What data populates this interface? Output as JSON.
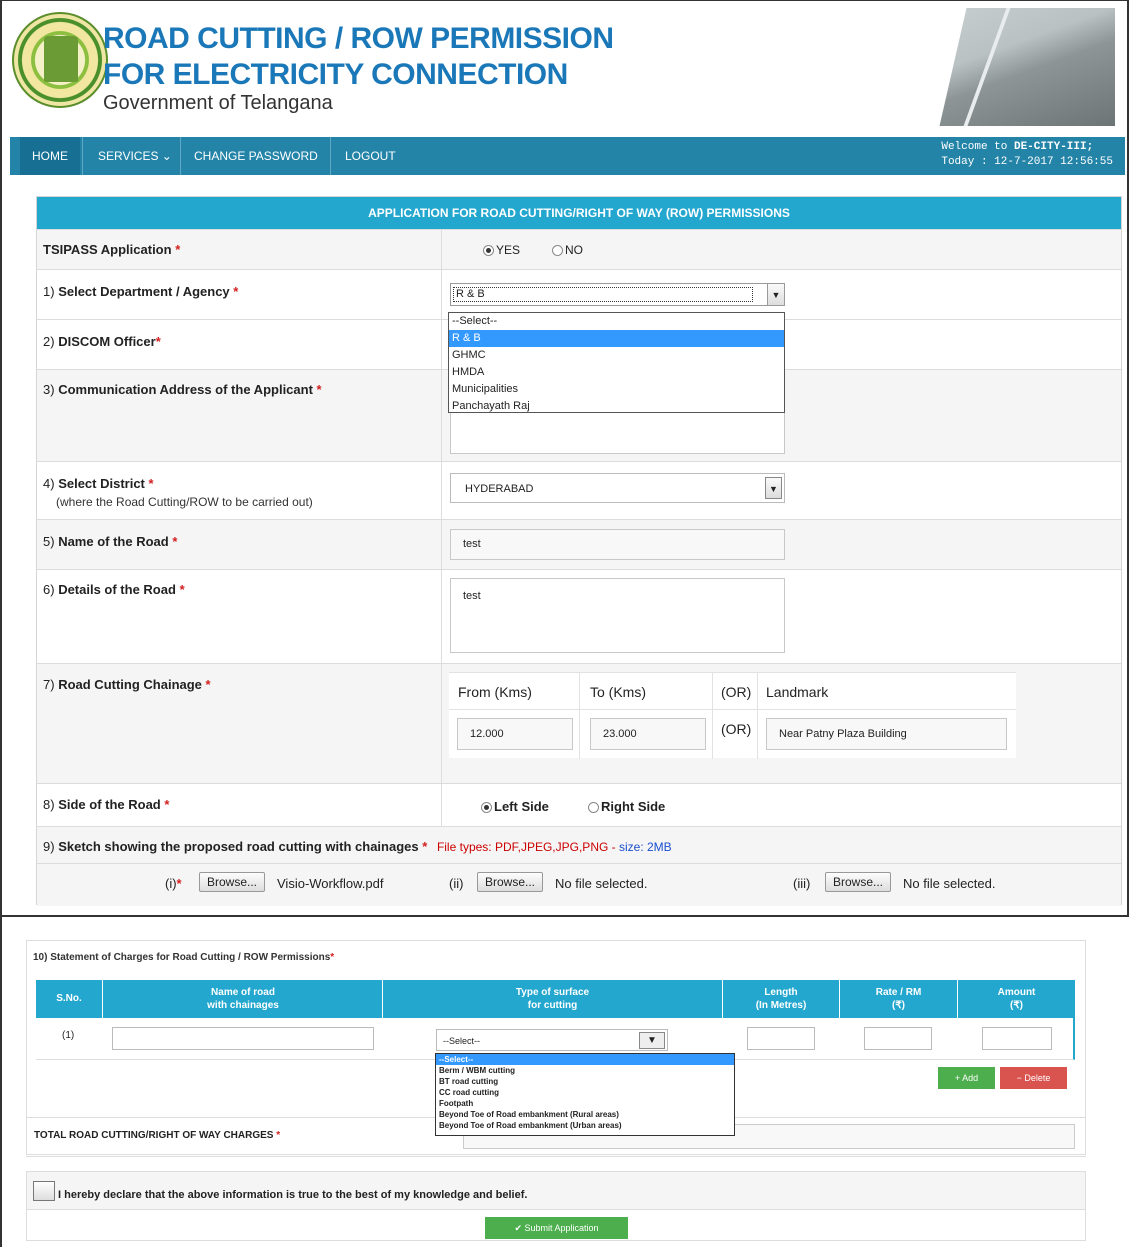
{
  "header": {
    "title_line1": "ROAD CUTTING / ROW PERMISSION",
    "title_line2": "FOR ELECTRICITY CONNECTION",
    "subtitle": "Government of Telangana",
    "emblem_text": "GOVERNMENT OF TELANGANA"
  },
  "nav": {
    "items": [
      "HOME",
      "SERVICES ⌄",
      "CHANGE PASSWORD",
      "LOGOUT"
    ],
    "welcome_prefix": "Welcome to ",
    "welcome_user": "DE-CITY-III;",
    "today": "Today : 12-7-2017 12:56:55"
  },
  "form": {
    "heading": "APPLICATION FOR ROAD CUTTING/RIGHT OF WAY (ROW) PERMISSIONS",
    "tsipass_label": "TSIPASS Application",
    "yes": "YES",
    "no": "NO",
    "dept_num": "1)",
    "dept_label": "Select Department / Agency",
    "dept_value": "R & B",
    "dept_options": [
      "--Select--",
      "R & B",
      "GHMC",
      "HMDA",
      "Municipalities",
      "Panchayath Raj"
    ],
    "discom_num": "2)",
    "discom_label": "DISCOM Officer",
    "address_num": "3)",
    "address_label": "Communication Address of the Applicant",
    "district_num": "4)",
    "district_label": "Select District",
    "district_note": "(where the Road Cutting/ROW to be carried out)",
    "district_value": "HYDERABAD",
    "road_num": "5)",
    "road_label": "Name of the Road",
    "road_value": "test",
    "details_num": "6)",
    "details_label": "Details of the Road",
    "details_value": "test",
    "chain_num": "7)",
    "chain_label": "Road Cutting Chainage",
    "from_label": "From (Kms)",
    "to_label": "To (Kms)",
    "or": "(OR)",
    "landmark_label": "Landmark",
    "from_value": "12.000",
    "to_value": "23.000",
    "landmark_value": "Near Patny Plaza Building",
    "side_num": "8)",
    "side_label": "Side of the Road",
    "left_side": "Left Side",
    "right_side": "Right Side",
    "sketch_num": "9)",
    "sketch_label": "Sketch showing the proposed road cutting with chainages",
    "file_types": "File types: PDF,JPEG,JPG,PNG",
    "size_sep": " - ",
    "size": "size: 2MB",
    "file1_idx": "(i)",
    "file2_idx": "(ii)",
    "file3_idx": "(iii)",
    "browse": "Browse...",
    "file1": "Visio-Workflow.pdf",
    "nofile": "No file selected."
  },
  "charges": {
    "title": "10) Statement of Charges for Road Cutting / ROW Permissions",
    "headers": [
      "S.No.",
      "Name of road\nwith chainages",
      "Type of surface\nfor cutting",
      "Length\n(In Metres)",
      "Rate / RM\n(₹)",
      "Amount\n(₹)"
    ],
    "row_no": "(1)",
    "surface_value": "--Select--",
    "surface_options": [
      "--Select--",
      "Berm / WBM cutting",
      "BT road cutting",
      "CC road cutting",
      "Footpath",
      "Beyond Toe of Road embankment (Rural areas)",
      "Beyond Toe of Road embankment (Urban areas)"
    ],
    "add": "+ Add",
    "delete": "− Delete",
    "total_label": "TOTAL ROAD CUTTING/RIGHT OF WAY CHARGES",
    "declare": "I hereby declare that the above information is true to the best of my knowledge and belief.",
    "submit": "✔ Submit Application"
  },
  "colors": {
    "nav": "#2384a8",
    "header_bar": "#24a7cf",
    "title": "#1b78b8",
    "required": "#d21f1f"
  }
}
